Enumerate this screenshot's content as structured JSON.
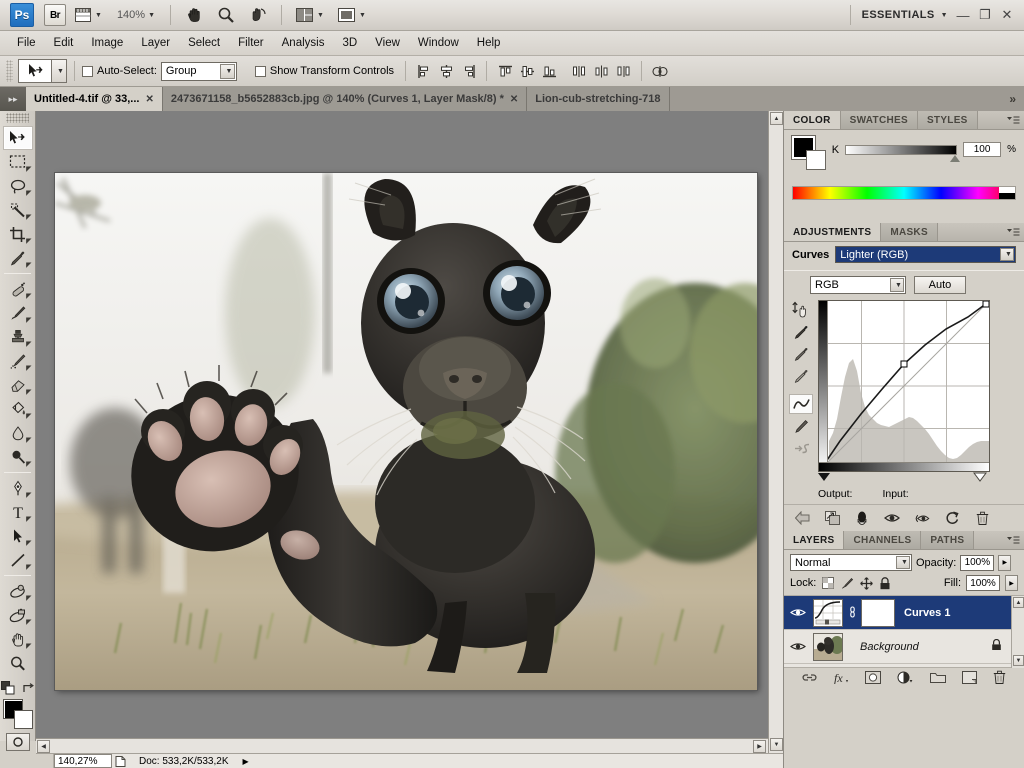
{
  "app": {
    "logo": "Ps",
    "workspace": "ESSENTIALS",
    "bridge_label": "Br",
    "zoom_level": "140%",
    "window_minimize": "—",
    "window_restore": "❐",
    "window_close": "✕"
  },
  "menu": {
    "items": [
      "File",
      "Edit",
      "Image",
      "Layer",
      "Select",
      "Filter",
      "Analysis",
      "3D",
      "View",
      "Window",
      "Help"
    ]
  },
  "options_bar": {
    "auto_select_label": "Auto-Select:",
    "auto_select_value": "Group",
    "show_transform_label": "Show Transform Controls"
  },
  "tabs": {
    "items": [
      {
        "title": "Untitled-4.tif @ 33,...",
        "active": true,
        "close": "✕"
      },
      {
        "title": "2473671158_b5652883cb.jpg @ 140% (Curves 1, Layer Mask/8) *",
        "active": false,
        "close": "✕"
      },
      {
        "title": "Lion-cub-stretching-718",
        "active": false,
        "close": ""
      }
    ],
    "overflow": "»"
  },
  "toolbox": {
    "tools": [
      {
        "name": "move-tool",
        "selected": true
      },
      {
        "name": "marquee-tool",
        "selected": false
      },
      {
        "name": "lasso-tool",
        "selected": false
      },
      {
        "name": "magic-wand-tool",
        "selected": false
      },
      {
        "name": "crop-tool",
        "selected": false
      },
      {
        "name": "eyedropper-tool",
        "selected": false
      },
      {
        "name": "healing-brush-tool",
        "selected": false
      },
      {
        "name": "brush-tool",
        "selected": false
      },
      {
        "name": "clone-stamp-tool",
        "selected": false
      },
      {
        "name": "history-brush-tool",
        "selected": false
      },
      {
        "name": "eraser-tool",
        "selected": false
      },
      {
        "name": "gradient-tool",
        "selected": false
      },
      {
        "name": "blur-tool",
        "selected": false
      },
      {
        "name": "dodge-tool",
        "selected": false
      },
      {
        "name": "pen-tool",
        "selected": false
      },
      {
        "name": "type-tool",
        "selected": false
      },
      {
        "name": "path-selection-tool",
        "selected": false
      },
      {
        "name": "line-shape-tool",
        "selected": false
      },
      {
        "name": "3d-rotate-tool",
        "selected": false
      },
      {
        "name": "3d-orbit-camera-tool",
        "selected": false
      },
      {
        "name": "hand-tool",
        "selected": false
      },
      {
        "name": "zoom-tool",
        "selected": false
      }
    ],
    "foreground_color": "#000000",
    "background_color": "#ffffff"
  },
  "document": {
    "zoom_field": "140,27%",
    "doc_info": "Doc: 533,2K/533,2K",
    "image_subject": "black jaguar cub reaching toward camera"
  },
  "color_panel": {
    "tabs": [
      "COLOR",
      "SWATCHES",
      "STYLES"
    ],
    "active_tab": "COLOR",
    "channel_label": "K",
    "channel_value": "100",
    "unit": "%",
    "foreground_color": "#000000",
    "background_color": "#ffffff"
  },
  "adjustments_panel": {
    "tabs": [
      "ADJUSTMENTS",
      "MASKS"
    ],
    "active_tab": "ADJUSTMENTS",
    "adjustment_name": "Curves",
    "preset_value": "Lighter (RGB)",
    "channel_value": "RGB",
    "auto_button": "Auto",
    "output_label": "Output:",
    "input_label": "Input:",
    "output_value": "",
    "input_value": ""
  },
  "curves_data": {
    "type": "line",
    "title": "Curves RGB",
    "xlabel": "Input",
    "ylabel": "Output",
    "xlim": [
      0,
      255
    ],
    "ylim": [
      0,
      255
    ],
    "grid": true,
    "baseline": [
      [
        0,
        0
      ],
      [
        255,
        255
      ]
    ],
    "control_points": [
      [
        0,
        0
      ],
      [
        128,
        160
      ],
      [
        255,
        255
      ]
    ],
    "curve_points": [
      [
        0,
        0
      ],
      [
        32,
        44
      ],
      [
        64,
        86
      ],
      [
        96,
        124
      ],
      [
        128,
        160
      ],
      [
        160,
        190
      ],
      [
        192,
        215
      ],
      [
        224,
        238
      ],
      [
        255,
        255
      ]
    ],
    "black_input_marker": 0,
    "white_input_marker": 255
  },
  "layers_panel": {
    "tabs": [
      "LAYERS",
      "CHANNELS",
      "PATHS"
    ],
    "active_tab": "LAYERS",
    "blend_mode": "Normal",
    "opacity_label": "Opacity:",
    "opacity_value": "100%",
    "lock_label": "Lock:",
    "fill_label": "Fill:",
    "fill_value": "100%",
    "layers": [
      {
        "name": "Curves 1",
        "selected": true,
        "visible": true,
        "type": "adjustment",
        "locked": false
      },
      {
        "name": "Background",
        "selected": false,
        "visible": true,
        "type": "image",
        "locked": true
      }
    ]
  }
}
